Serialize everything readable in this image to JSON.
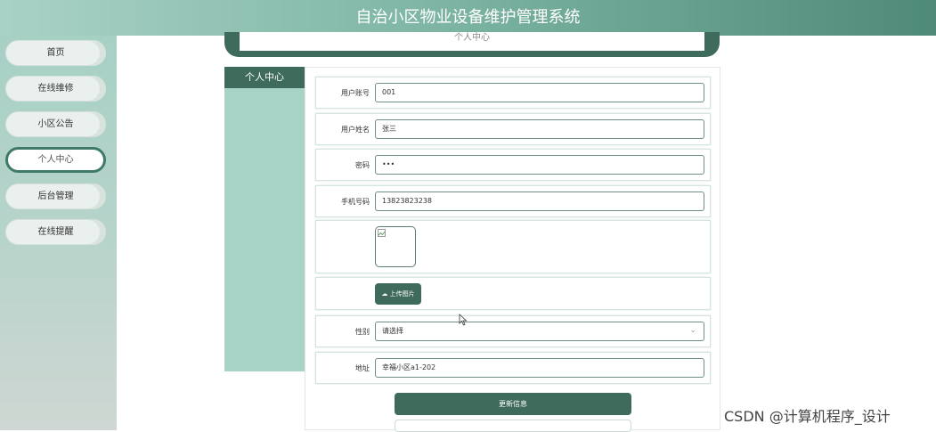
{
  "header": {
    "title": "自治小区物业设备维护管理系统"
  },
  "sidebar": {
    "items": [
      {
        "label": "首页"
      },
      {
        "label": "在线维修"
      },
      {
        "label": "小区公告"
      },
      {
        "label": "个人中心"
      },
      {
        "label": "后台管理"
      },
      {
        "label": "在线提醒"
      }
    ],
    "active": "个人中心"
  },
  "top_card": {
    "title": "个人中心"
  },
  "panel": {
    "title": "个人中心"
  },
  "form": {
    "account_label": "用户账号",
    "account_value": "001",
    "name_label": "用户姓名",
    "name_value": "张三",
    "password_label": "密码",
    "password_value": "•••",
    "phone_label": "手机号码",
    "phone_value": "13823823238",
    "upload_label": "上传图片",
    "gender_label": "性别",
    "gender_value": "请选择",
    "address_label": "地址",
    "address_value": "幸福小区a1-202",
    "submit_label": "更新信息"
  },
  "watermark": "CSDN @计算机程序_设计",
  "colors": {
    "accent": "#3f6b5d",
    "sidebar": "#a8d3c7"
  }
}
